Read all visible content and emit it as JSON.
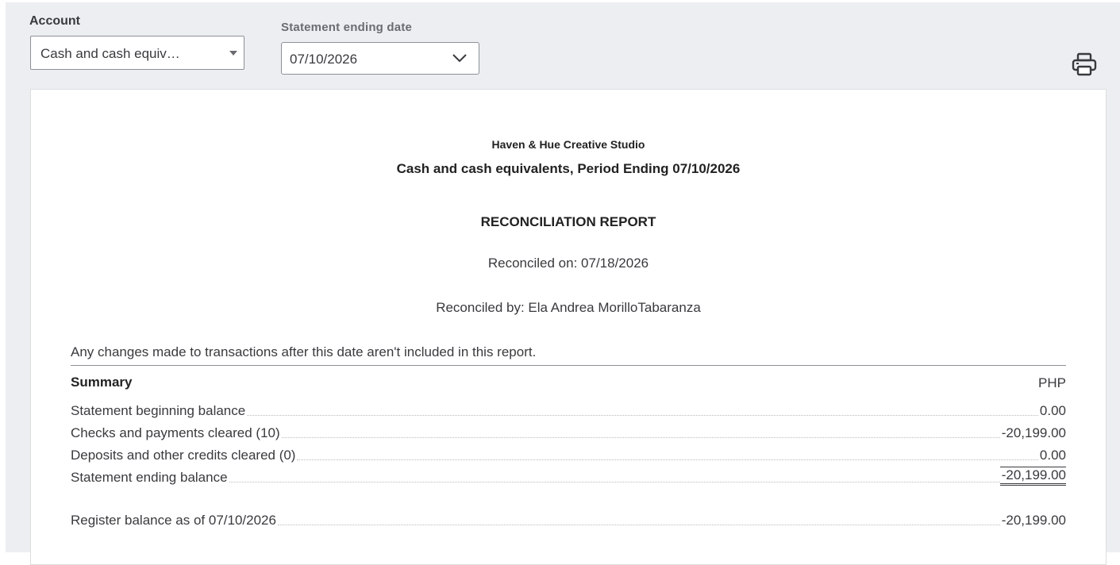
{
  "filters": {
    "account_label": "Account",
    "account_value": "Cash and cash equiv…",
    "date_label": "Statement ending date",
    "date_value": "07/10/2026"
  },
  "report": {
    "company": "Haven & Hue Creative Studio",
    "subtitle": "Cash and cash equivalents, Period Ending 07/10/2026",
    "title": "RECONCILIATION REPORT",
    "reconciled_on": "Reconciled on: 07/18/2026",
    "reconciled_by": "Reconciled by: Ela Andrea MorilloTabaranza",
    "notice": "Any changes made to transactions after this date aren't included in this report.",
    "summary_heading": "Summary",
    "currency": "PHP",
    "rows": [
      {
        "label": "Statement beginning balance",
        "amount": "0.00"
      },
      {
        "label": "Checks and payments cleared (10)",
        "amount": "-20,199.00"
      },
      {
        "label": "Deposits and other credits cleared (0)",
        "amount": "0.00"
      },
      {
        "label": "Statement ending balance",
        "amount": "-20,199.00"
      },
      {
        "label": "Register balance as of 07/10/2026",
        "amount": "-20,199.00"
      }
    ]
  },
  "icons": {
    "print": "printer-icon",
    "date_dropdown": "chevron-down-icon",
    "account_dropdown": "caret-down-icon"
  }
}
